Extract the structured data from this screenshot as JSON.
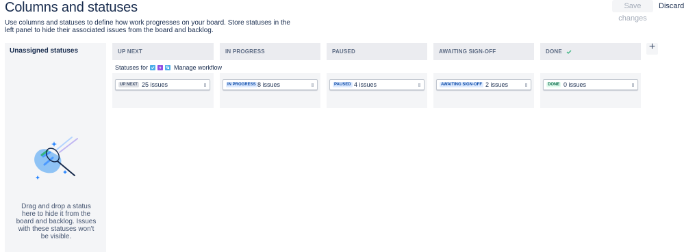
{
  "header": {
    "title": "Columns and statuses",
    "save_label": "Save changes",
    "discard_label": "Discard",
    "description": "Use columns and statuses to define how work progresses on your board. Store statuses in the left panel to hide their associated issues from the board and backlog."
  },
  "unassigned": {
    "title": "Unassigned statuses",
    "hint": "Drag and drop a status here to hide it from the board and backlog. Issues with these statuses won't be visible."
  },
  "statuses_for": {
    "label": "Statuses for",
    "icons": [
      "task-icon",
      "epic-icon",
      "subtask-icon"
    ],
    "manage_label": "Manage workflow"
  },
  "columns": [
    {
      "header": "UP NEXT",
      "lozenge": "UP NEXT",
      "issues": "25 issues",
      "lozenge_bg": "#dfe1e6",
      "lozenge_fg": "#42526e"
    },
    {
      "header": "IN PROGRESS",
      "lozenge": "IN PROGRESS",
      "issues": "8 issues",
      "lozenge_bg": "#deebff",
      "lozenge_fg": "#0747a6"
    },
    {
      "header": "PAUSED",
      "lozenge": "PAUSED",
      "issues": "4 issues",
      "lozenge_bg": "#deebff",
      "lozenge_fg": "#0747a6"
    },
    {
      "header": "AWAITING SIGN-OFF",
      "lozenge": "AWAITING SIGN-OFF",
      "issues": "2 issues",
      "lozenge_bg": "#deebff",
      "lozenge_fg": "#0747a6"
    },
    {
      "header": "DONE",
      "lozenge": "DONE",
      "issues": "0 issues",
      "lozenge_bg": "#e3fcef",
      "lozenge_fg": "#006644"
    }
  ],
  "add_column": {
    "symbol": "+"
  },
  "colors": {
    "done_check": "#36b37e",
    "task": "#4bade8",
    "epic": "#904ee2"
  }
}
